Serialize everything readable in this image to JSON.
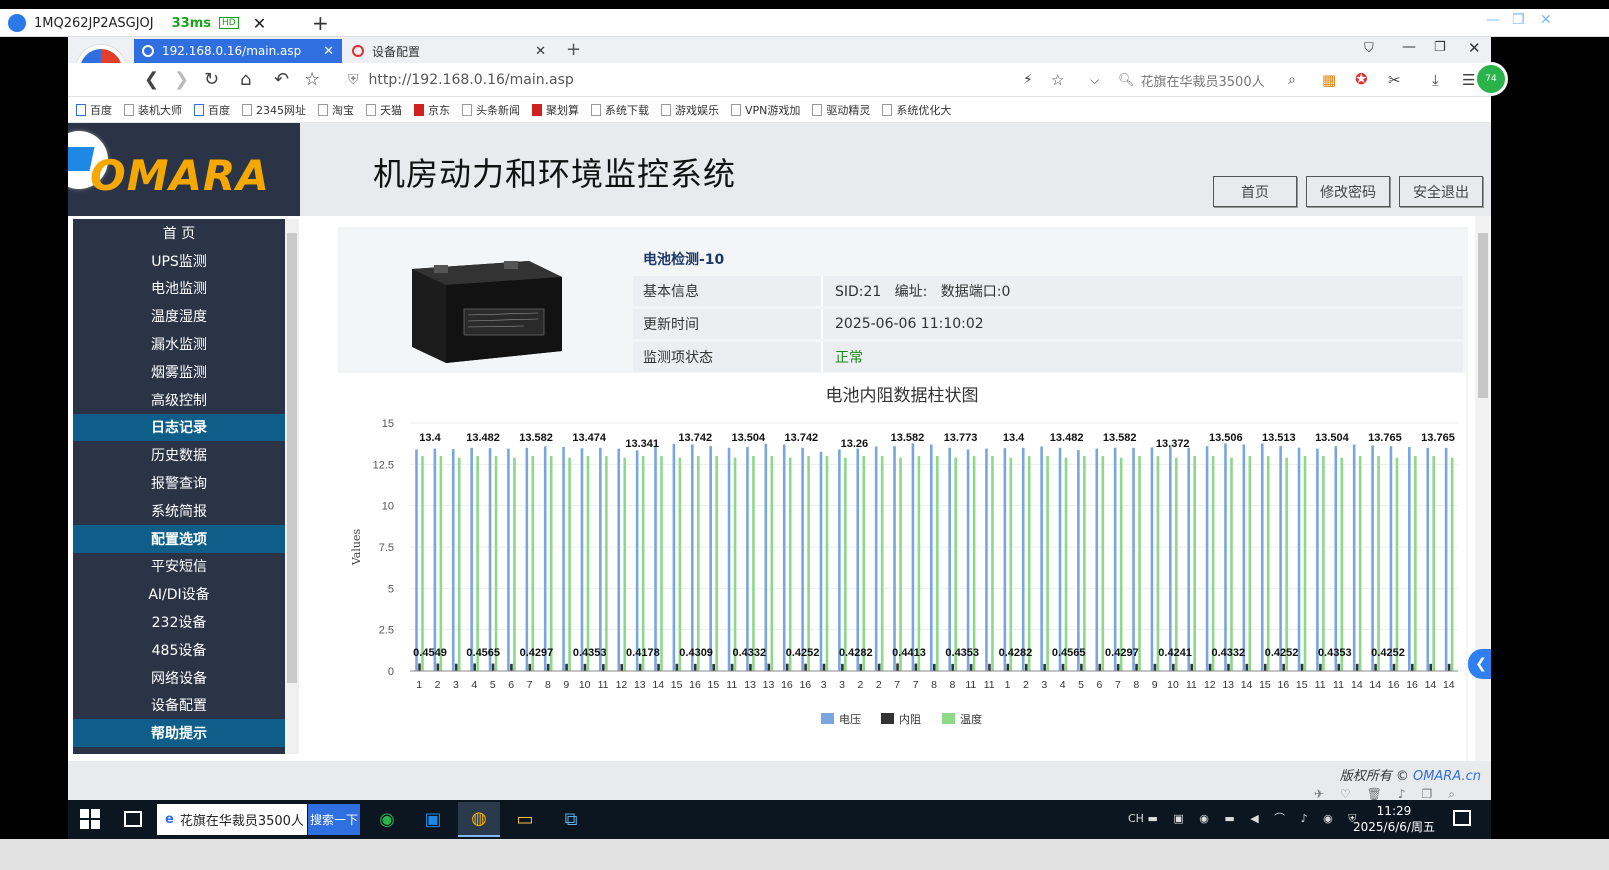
{
  "remote": {
    "tab_title": "1MQ262JP2ASGJOJ",
    "latency": "33ms",
    "quality": "HD"
  },
  "browser": {
    "tabs": [
      {
        "label": "192.168.0.16/main.asp",
        "active": true
      },
      {
        "label": "设备配置",
        "active": false
      }
    ],
    "url": "http://192.168.0.16/main.asp",
    "search_placeholder": "花旗在华裁员3500人",
    "bookmarks": [
      "百度",
      "装机大师",
      "百度",
      "2345网址",
      "淘宝",
      "天猫",
      "京东",
      "头条新闻",
      "聚划算",
      "系统下载",
      "游戏娱乐",
      "VPN游戏加",
      "驱动精灵",
      "系统优化大"
    ],
    "ext_badge": "74"
  },
  "header": {
    "brand": "OMARA",
    "title": "机房动力和环境监控系统",
    "buttons": {
      "home": "首页",
      "change_password": "修改密码",
      "logout": "安全退出"
    }
  },
  "sidebar": {
    "items": [
      {
        "label": "首 页",
        "header": false
      },
      {
        "label": "UPS监测",
        "header": false
      },
      {
        "label": "电池监测",
        "header": false
      },
      {
        "label": "温度湿度",
        "header": false
      },
      {
        "label": "漏水监测",
        "header": false
      },
      {
        "label": "烟雾监测",
        "header": false
      },
      {
        "label": "高级控制",
        "header": false
      },
      {
        "label": "日志记录",
        "header": true
      },
      {
        "label": "历史数据",
        "header": false
      },
      {
        "label": "报警查询",
        "header": false
      },
      {
        "label": "系统简报",
        "header": false
      },
      {
        "label": "配置选项",
        "header": true
      },
      {
        "label": "平安短信",
        "header": false
      },
      {
        "label": "AI/DI设备",
        "header": false
      },
      {
        "label": "232设备",
        "header": false
      },
      {
        "label": "485设备",
        "header": false
      },
      {
        "label": "网络设备",
        "header": false
      },
      {
        "label": "设备配置",
        "header": false
      },
      {
        "label": "帮助提示",
        "header": true
      }
    ]
  },
  "device": {
    "title": "电池检测-10",
    "rows": [
      {
        "key": "基本信息",
        "value": "SID:21   编址:   数据端口:0"
      },
      {
        "key": "更新时间",
        "value": "2025-06-06 11:10:02"
      },
      {
        "key": "监测项状态",
        "value": "正常",
        "color": "#1a8a1a"
      }
    ]
  },
  "chart_data": {
    "type": "bar",
    "title": "电池内阻数据柱状图",
    "ylabel": "Values",
    "ylim": [
      0,
      15
    ],
    "yticks": [
      0,
      2.5,
      5,
      7.5,
      10,
      12.5,
      15
    ],
    "categories": [
      "1",
      "2",
      "3",
      "4",
      "5",
      "6",
      "7",
      "8",
      "9",
      "10",
      "11",
      "12",
      "13",
      "14",
      "15",
      "16",
      "15",
      "11",
      "13",
      "13",
      "16",
      "16",
      "3",
      "3",
      "2",
      "2",
      "7",
      "7",
      "8",
      "8",
      "11",
      "11",
      "1",
      "2",
      "3",
      "4",
      "5",
      "6",
      "7",
      "8",
      "9",
      "10",
      "11",
      "12",
      "13",
      "14",
      "15",
      "16",
      "15",
      "11",
      "11",
      "14",
      "14",
      "16",
      "16",
      "14",
      "14"
    ],
    "series": [
      {
        "name": "电压",
        "color": "#7aa6e0",
        "values": [
          13.4,
          13.45,
          13.42,
          13.5,
          13.482,
          13.45,
          13.5,
          13.582,
          13.55,
          13.474,
          13.5,
          13.45,
          13.341,
          13.6,
          13.742,
          13.7,
          13.6,
          13.504,
          13.55,
          13.742,
          13.7,
          13.5,
          13.26,
          13.4,
          13.45,
          13.582,
          13.6,
          13.773,
          13.7,
          13.5,
          13.4,
          13.45,
          13.482,
          13.5,
          13.582,
          13.5,
          13.372,
          13.45,
          13.506,
          13.5,
          13.513,
          13.55,
          13.504,
          13.6,
          13.765,
          13.7,
          13.765,
          13.6,
          13.5,
          13.45,
          13.6,
          13.7,
          13.65,
          13.6,
          13.55,
          13.5,
          13.5
        ]
      },
      {
        "name": "内阻",
        "color": "#333333",
        "values": [
          0.4549,
          0.45,
          0.44,
          0.4565,
          0.45,
          0.43,
          0.4297,
          0.43,
          0.4353,
          0.43,
          0.4178,
          0.42,
          0.4309,
          0.43,
          0.4332,
          0.43,
          0.4252,
          0.43,
          0.4282,
          0.44,
          0.4413,
          0.44,
          0.4353,
          0.43,
          0.4282,
          0.44,
          0.4565,
          0.45,
          0.4297,
          0.43,
          0.4241,
          0.43,
          0.4332,
          0.43,
          0.4252,
          0.43,
          0.4353,
          0.43,
          0.4252,
          0.43,
          0.43,
          0.43,
          0.43,
          0.43,
          0.43,
          0.43,
          0.43,
          0.43,
          0.43,
          0.43,
          0.43,
          0.43,
          0.43,
          0.43,
          0.43,
          0.43,
          0.43
        ]
      },
      {
        "name": "温度",
        "color": "#8ed88a",
        "values": [
          13.0,
          13.0,
          12.9,
          13.0,
          13.0,
          12.9,
          13.0,
          13.0,
          12.9,
          13.0,
          13.0,
          12.9,
          13.0,
          13.0,
          12.9,
          13.0,
          13.0,
          12.9,
          13.0,
          13.0,
          12.9,
          13.0,
          13.0,
          12.9,
          13.0,
          13.0,
          12.9,
          13.0,
          13.0,
          12.9,
          13.0,
          13.0,
          12.9,
          13.0,
          13.0,
          12.9,
          13.0,
          13.0,
          12.9,
          13.0,
          13.0,
          12.9,
          13.0,
          13.0,
          12.9,
          13.0,
          13.0,
          12.9,
          13.0,
          13.0,
          12.9,
          13.0,
          13.0,
          12.9,
          13.0,
          13.0,
          12.9
        ]
      }
    ],
    "top_labels": [
      "13.4",
      "13.482",
      "13.582",
      "13.474",
      "13.341",
      "13.742",
      "13.504",
      "13.742",
      "13.26",
      "13.582",
      "13.773",
      "13.4",
      "13.482",
      "13.582",
      "13.372",
      "13.506",
      "13.513",
      "13.504",
      "13.765",
      "13.765"
    ],
    "bottom_labels": [
      "0.4549",
      "0.4565",
      "0.4297",
      "0.4353",
      "0.4178",
      "0.4309",
      "0.4332",
      "0.4252",
      "0.4282",
      "0.4413",
      "0.4353",
      "0.4282",
      "0.4565",
      "0.4297",
      "0.4241",
      "0.4332",
      "0.4252",
      "0.4353",
      "0.4252"
    ],
    "legend_position": "bottom-center",
    "grid": true
  },
  "footer": {
    "copyright": "版权所有 ©",
    "link": "OMARA.cn"
  },
  "taskbar": {
    "search_text": "花旗在华裁员3500人",
    "search_button": "搜索一下",
    "tray_lang": "CH",
    "time": "11:29",
    "date": "2025/6/6/周五"
  }
}
